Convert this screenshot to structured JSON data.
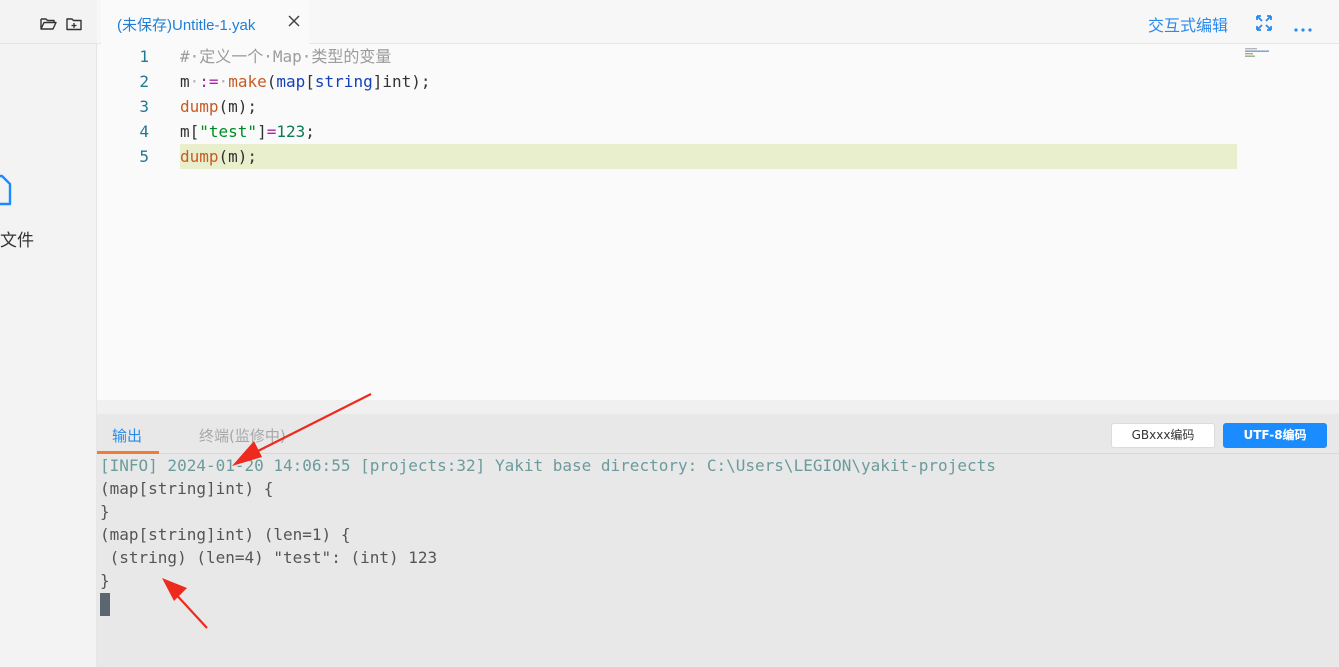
{
  "sidebar": {
    "file_label": "文件"
  },
  "tab": {
    "title": "(未保存)Untitle-1.yak"
  },
  "toolbar": {
    "interactive_edit_label": "交互式编辑"
  },
  "editor": {
    "line_numbers": [
      "1",
      "2",
      "3",
      "4",
      "5"
    ],
    "current_line": 5,
    "lines": [
      [
        {
          "t": "#·定义一个·Map·类型的变量",
          "k": "comment"
        }
      ],
      [
        {
          "t": "m",
          "k": "ident"
        },
        {
          "t": "·",
          "k": "ws"
        },
        {
          "t": ":=",
          "k": "op"
        },
        {
          "t": "·",
          "k": "ws"
        },
        {
          "t": "make",
          "k": "fn"
        },
        {
          "t": "(",
          "k": "ident"
        },
        {
          "t": "map",
          "k": "kw"
        },
        {
          "t": "[",
          "k": "ident"
        },
        {
          "t": "string",
          "k": "kw"
        },
        {
          "t": "]",
          "k": "ident"
        },
        {
          "t": "int",
          "k": "ident"
        },
        {
          "t": ");",
          "k": "ident"
        }
      ],
      [
        {
          "t": "dump",
          "k": "fn"
        },
        {
          "t": "(m);",
          "k": "ident"
        }
      ],
      [
        {
          "t": "m[",
          "k": "ident"
        },
        {
          "t": "\"test\"",
          "k": "str"
        },
        {
          "t": "]",
          "k": "ident"
        },
        {
          "t": "=",
          "k": "op"
        },
        {
          "t": "123",
          "k": "num"
        },
        {
          "t": ";",
          "k": "ident"
        }
      ],
      [
        {
          "t": "dump",
          "k": "fn"
        },
        {
          "t": "(m);",
          "k": "ident"
        }
      ]
    ]
  },
  "panel": {
    "tab_output": "输出",
    "tab_terminal": "终端(监修中)",
    "btn_gbk": "GBxxx编码",
    "btn_utf8": "UTF-8编码",
    "output_lines": [
      {
        "text": "[INFO] 2024-01-20 14:06:55 [projects:32] Yakit base directory: C:\\Users\\LEGION\\yakit-projects",
        "kind": "info"
      },
      {
        "text": "(map[string]int) {",
        "kind": "plain"
      },
      {
        "text": "}",
        "kind": "plain"
      },
      {
        "text": "(map[string]int) (len=1) {",
        "kind": "plain"
      },
      {
        "text": " (string) (len=4) \"test\": (int) 123",
        "kind": "plain"
      },
      {
        "text": "}",
        "kind": "plain"
      }
    ]
  },
  "colors": {
    "accent": "#1a8cff",
    "tab_underline": "#f27b35",
    "current_line": "#e9efcc",
    "annotation_arrow": "#ee2a1f"
  }
}
